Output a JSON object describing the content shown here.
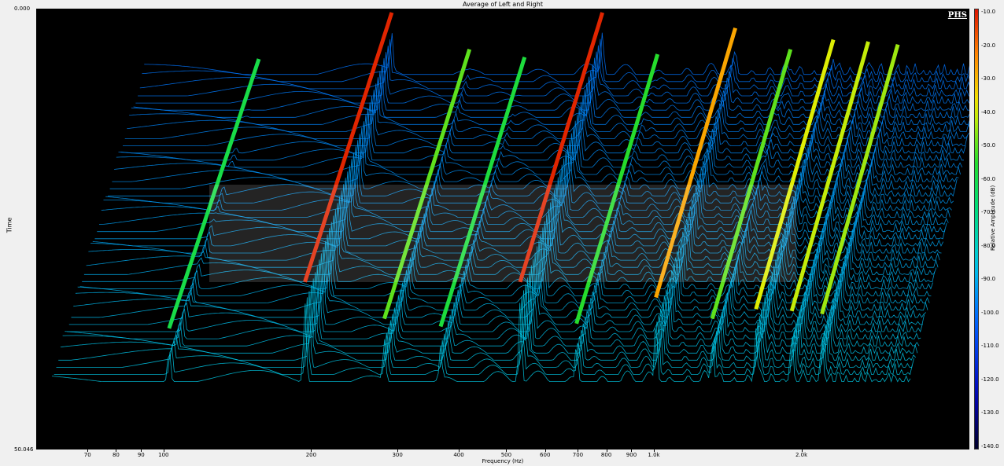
{
  "chart_data": {
    "type": "waterfall",
    "title": "Average of Left and Right",
    "xlabel": "Frequency (Hz)",
    "ylabel": "Time",
    "colorbar_label": "Relative Amplitude (dB)",
    "brand": "PHS",
    "x_scale": "log",
    "xlim": [
      55,
      4400
    ],
    "x_ticks": [
      "70",
      "80",
      "90",
      "100",
      "200",
      "300",
      "400",
      "500",
      "600",
      "700",
      "800",
      "900",
      "1.0k",
      "2.0k"
    ],
    "x_tick_values": [
      70,
      80,
      90,
      100,
      200,
      300,
      400,
      500,
      600,
      700,
      800,
      900,
      1000,
      2000
    ],
    "y_ticks": [
      "0.000",
      "50.046"
    ],
    "y_range": [
      0.0,
      50.046
    ],
    "colorbar_ticks": [
      "-10.0",
      "-20.0",
      "-30.0",
      "-40.0",
      "-50.0",
      "-60.0",
      "-70.0",
      "-80.0",
      "-90.0",
      "-100.0",
      "-110.0",
      "-120.0",
      "-130.0",
      "-140.0"
    ],
    "colorbar_range": [
      -140,
      -10
    ],
    "peaks": [
      {
        "freq": 100,
        "level": -60
      },
      {
        "freq": 200,
        "level": -12
      },
      {
        "freq": 300,
        "level": -50
      },
      {
        "freq": 400,
        "level": -58
      },
      {
        "freq": 600,
        "level": -12
      },
      {
        "freq": 800,
        "level": -55
      },
      {
        "freq": 1200,
        "level": -28
      },
      {
        "freq": 1600,
        "level": -50
      },
      {
        "freq": 2000,
        "level": -40
      },
      {
        "freq": 2400,
        "level": -42
      },
      {
        "freq": 2800,
        "level": -45
      }
    ],
    "noise_floor_db": -95
  }
}
